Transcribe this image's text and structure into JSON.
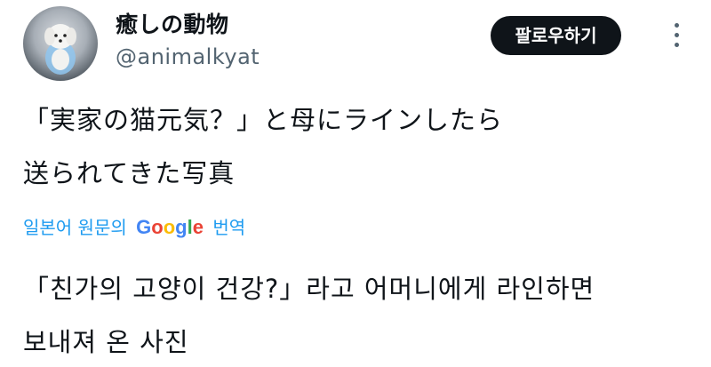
{
  "user": {
    "display_name": "癒しの動物",
    "handle": "@animalkyat"
  },
  "follow_button_label": "팔로우하기",
  "more_icon": "more-vertical-icon",
  "tweet_text_lines": [
    "「実家の猫元気？」と母にラインしたら",
    "送られてきた写真"
  ],
  "translation_notice": {
    "prefix": "일본어 원문의",
    "brand": "Google",
    "suffix": "번역"
  },
  "translated_lines": [
    "「친가의 고양이 건강?」라고 어머니에게 라인하면",
    "보내져 온 사진"
  ],
  "colors": {
    "link": "#1d9bf0",
    "text": "#0f1419",
    "secondary": "#536471",
    "button_bg": "#0f1419",
    "google_blue": "#4285F4",
    "google_red": "#EA4335",
    "google_yellow": "#FBBC05",
    "google_green": "#34A853"
  }
}
